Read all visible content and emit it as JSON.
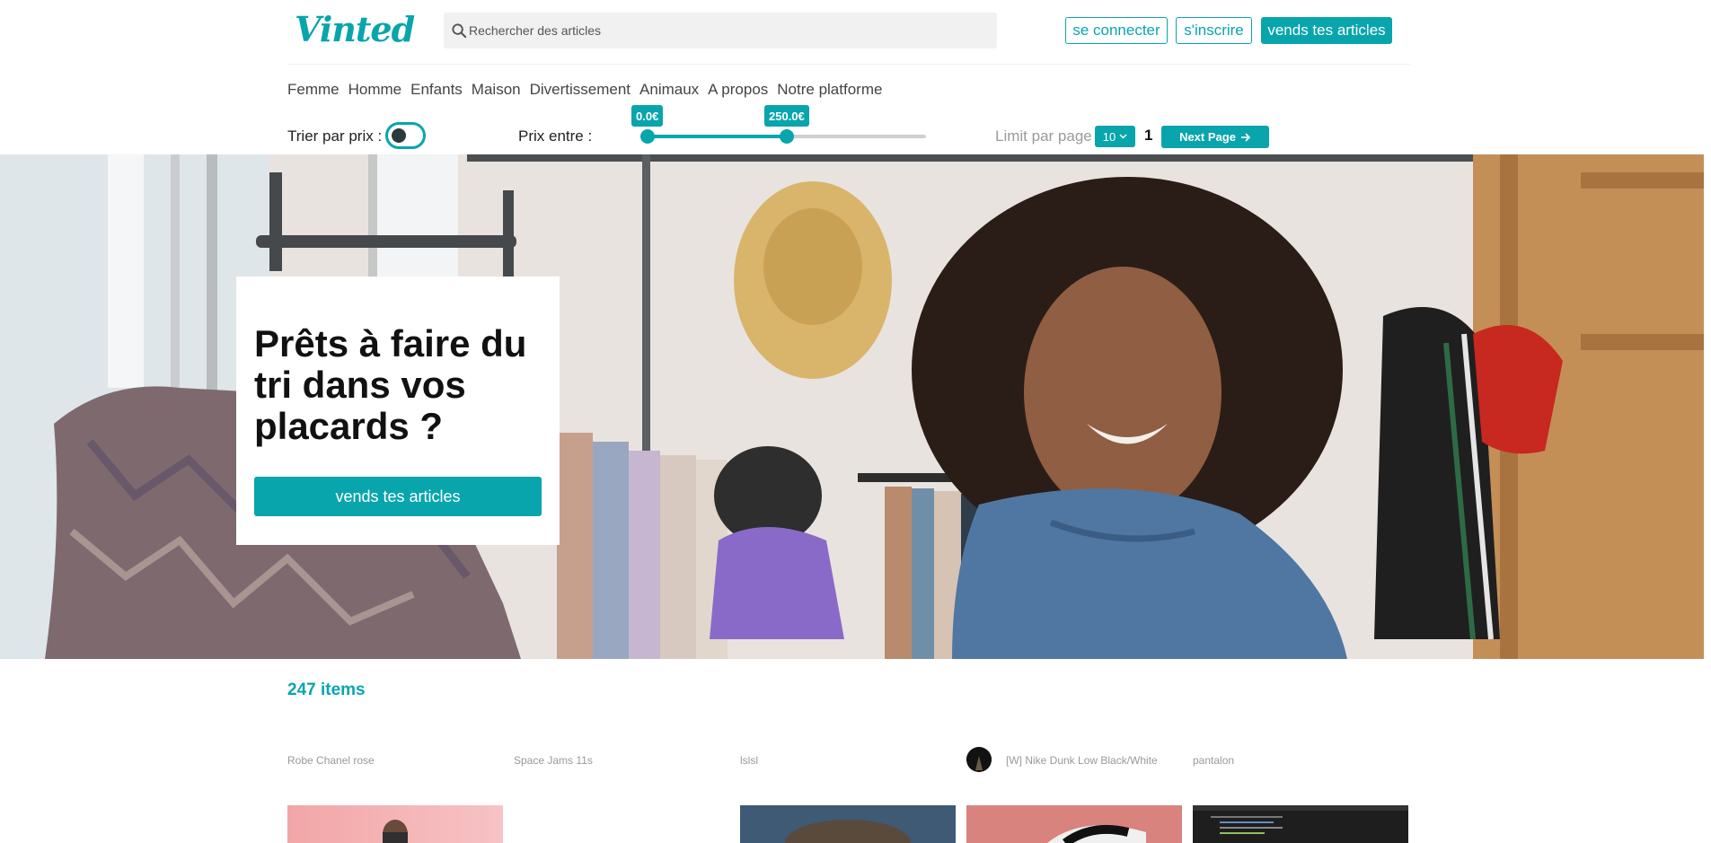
{
  "brand": {
    "logo_text": "Vinted",
    "accent_color": "#09a5ad"
  },
  "search": {
    "placeholder": "Rechercher des articles",
    "icon": "search-icon"
  },
  "header_buttons": {
    "login": "se connecter",
    "signup": "s'inscrire",
    "sell": "vends tes articles"
  },
  "nav": {
    "items": [
      "Femme",
      "Homme",
      "Enfants",
      "Maison",
      "Divertissement",
      "Animaux",
      "A propos",
      "Notre platforme"
    ]
  },
  "filters": {
    "sort_label": "Trier par prix :",
    "sort_toggle_on": false,
    "price_label": "Prix entre :",
    "price_min": "0.0€",
    "price_max": "250.0€",
    "limit_label": "Limit par page",
    "limit_value": "10",
    "page_number": "1",
    "next_label": "Next Page",
    "next_icon": "arrow-right-icon"
  },
  "hero": {
    "title": "Prêts à faire du tri dans vos placards ?",
    "cta": "vends tes articles"
  },
  "results": {
    "count_label": "247 items",
    "items": [
      {
        "title": "Robe Chanel rose",
        "has_avatar": false
      },
      {
        "title": "Space Jams 11s",
        "has_avatar": false
      },
      {
        "title": "lslsl",
        "has_avatar": false
      },
      {
        "title": "[W] Nike Dunk Low Black/White",
        "has_avatar": true
      },
      {
        "title": "pantalon",
        "has_avatar": false
      }
    ]
  }
}
